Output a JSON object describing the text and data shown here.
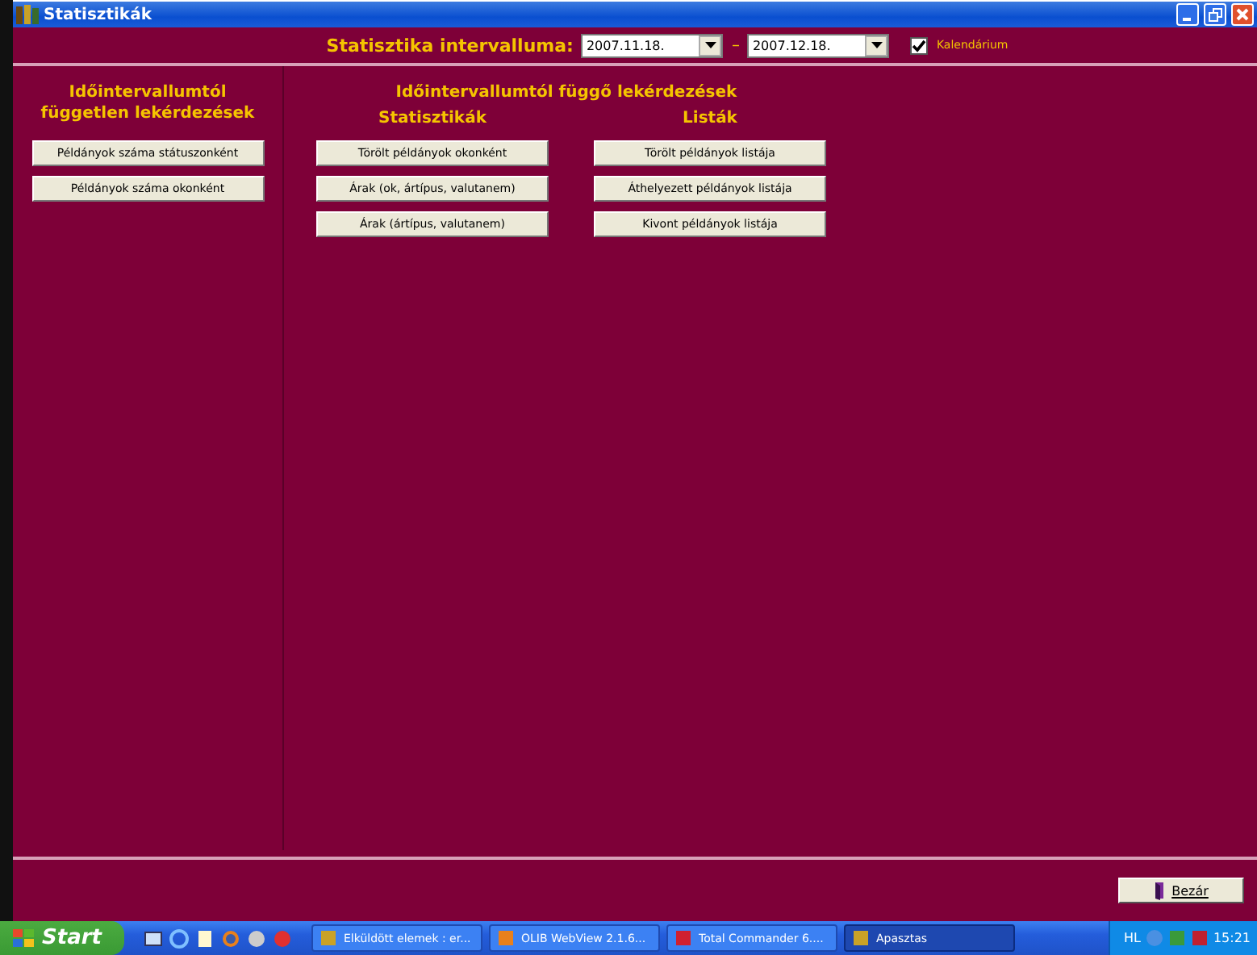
{
  "window": {
    "title": "Statisztikák"
  },
  "interval": {
    "label": "Statisztika intervalluma:",
    "from": "2007.11.18.",
    "separator": "–",
    "to": "2007.12.18.",
    "calendar": {
      "label": "Kalendárium",
      "checked": true
    }
  },
  "left_panel": {
    "title": "Időintervallumtól független lekérdezések",
    "buttons": [
      "Példányok száma státuszonként",
      "Példányok száma okonként"
    ]
  },
  "right_panel": {
    "title": "Időintervallumtól függő lekérdezések",
    "columns": [
      {
        "title": "Statisztikák",
        "buttons": [
          "Törölt példányok okonként",
          "Árak (ok, ártípus, valutanem)",
          "Árak (ártípus, valutanem)"
        ]
      },
      {
        "title": "Listák",
        "buttons": [
          "Törölt példányok listája",
          "Áthelyezett példányok listája",
          "Kivont példányok listája"
        ]
      }
    ]
  },
  "close_button": {
    "label": "Bezár"
  },
  "taskbar": {
    "start": "Start",
    "tasks": [
      {
        "label": "Elküldött elemek : er...",
        "selected": false
      },
      {
        "label": "OLIB WebView 2.1.6...",
        "selected": false
      },
      {
        "label": "Total Commander 6....",
        "selected": false
      },
      {
        "label": "Apasztas",
        "selected": true
      }
    ],
    "tray": {
      "language": "HL",
      "time": "15:21"
    }
  }
}
